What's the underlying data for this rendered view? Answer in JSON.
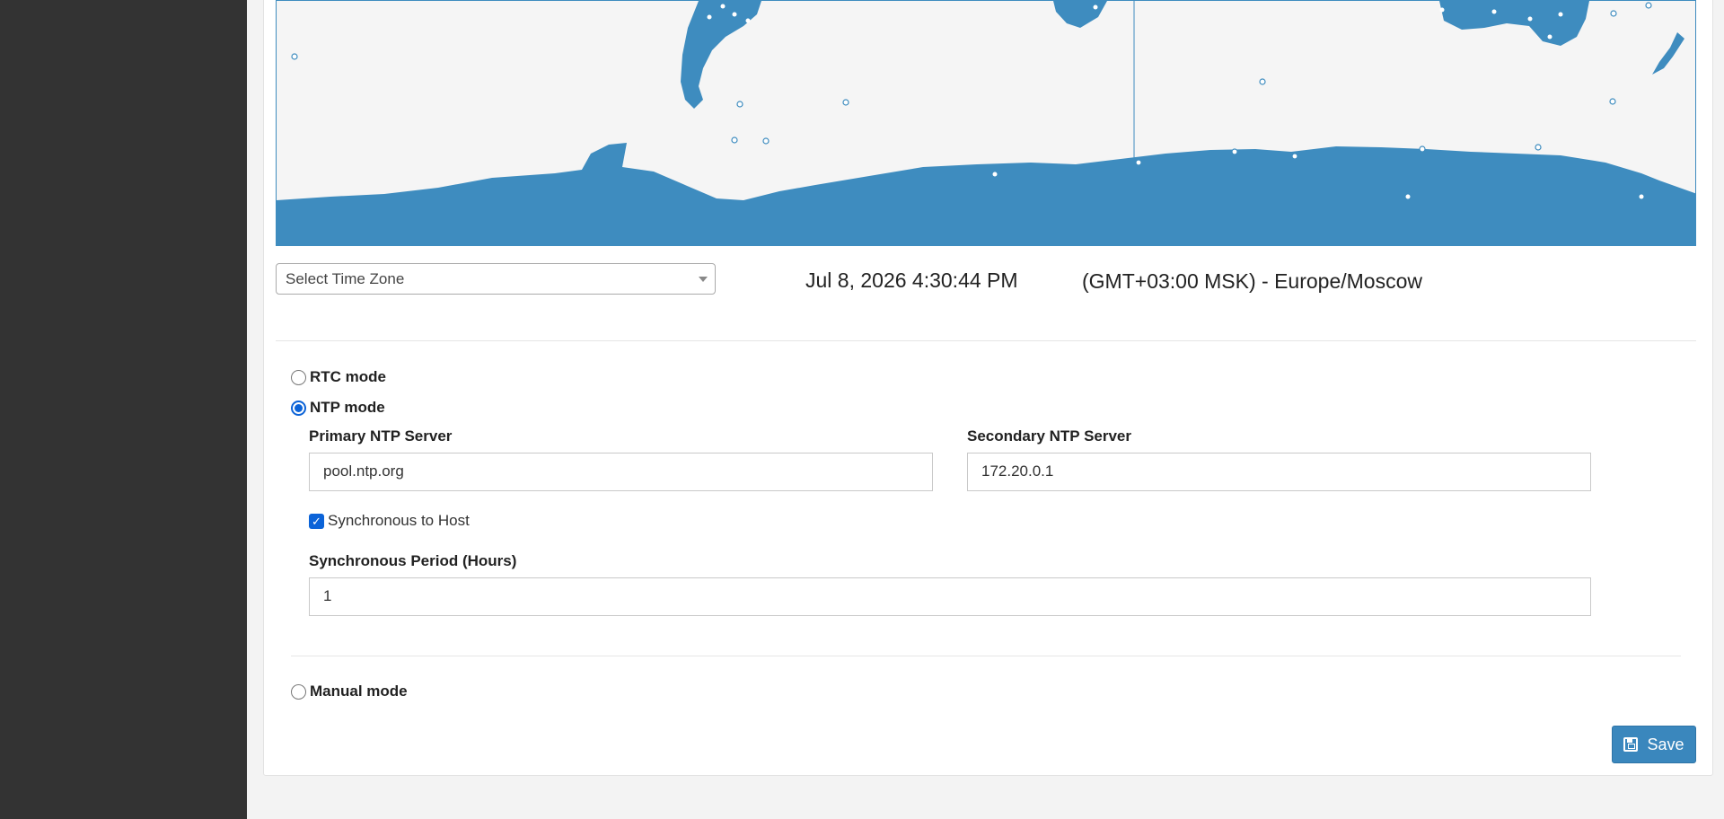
{
  "colors": {
    "sidebar": "#333333",
    "accent": "#3a87bd",
    "map_land": "#3e8cbf",
    "map_sea": "#f5f5f5",
    "radio_checked": "#0b63d8"
  },
  "timezone": {
    "select_placeholder": "Select Time Zone",
    "current_datetime": "Jul 8, 2026 4:30:44 PM",
    "current_zone": "(GMT+03:00 MSK) - Europe/Moscow"
  },
  "modes": {
    "rtc": {
      "label": "RTC mode",
      "selected": false
    },
    "ntp": {
      "label": "NTP mode",
      "selected": true
    },
    "manual": {
      "label": "Manual mode",
      "selected": false
    }
  },
  "ntp": {
    "primary_label": "Primary NTP Server",
    "primary_value": "pool.ntp.org",
    "secondary_label": "Secondary NTP Server",
    "secondary_value": "172.20.0.1",
    "sync_host_label": "Synchronous to Host",
    "sync_host_checked": true,
    "period_label": "Synchronous Period (Hours)",
    "period_value": "1"
  },
  "actions": {
    "save_label": "Save",
    "save_icon": "floppy-disk-icon"
  }
}
